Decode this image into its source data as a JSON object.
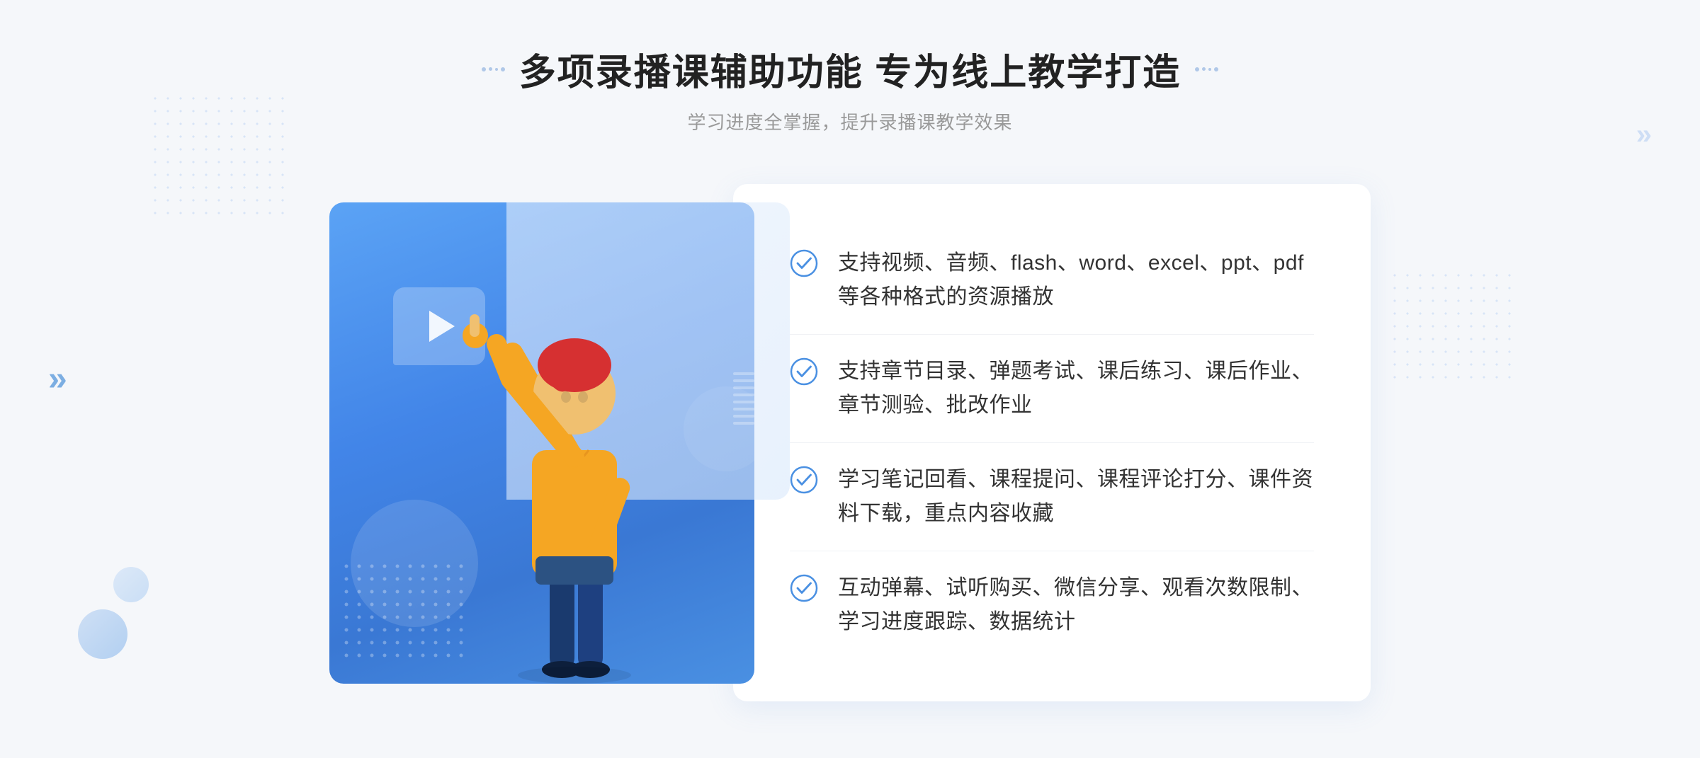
{
  "header": {
    "main_title": "多项录播课辅助功能 专为线上教学打造",
    "subtitle": "学习进度全掌握，提升录播课教学效果"
  },
  "features": [
    {
      "id": "feature-1",
      "text": "支持视频、音频、flash、word、excel、ppt、pdf等各种格式的资源播放"
    },
    {
      "id": "feature-2",
      "text": "支持章节目录、弹题考试、课后练习、课后作业、章节测验、批改作业"
    },
    {
      "id": "feature-3",
      "text": "学习笔记回看、课程提问、课程评论打分、课件资料下载，重点内容收藏"
    },
    {
      "id": "feature-4",
      "text": "互动弹幕、试听购买、微信分享、观看次数限制、学习进度跟踪、数据统计"
    }
  ],
  "decorators": {
    "left_dots_label": "dots-left",
    "right_dots_label": "dots-right",
    "chevron_left": "«",
    "chevron_right": "»"
  }
}
